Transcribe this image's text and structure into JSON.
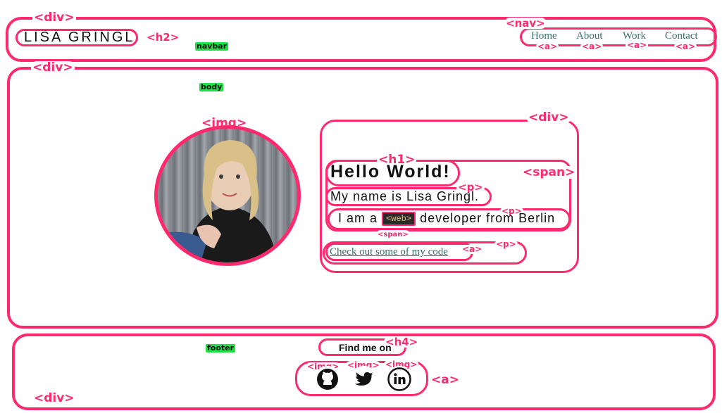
{
  "labels": {
    "div": "<div>",
    "nav": "<nav>",
    "h2": "<h2>",
    "a": "<a>",
    "img": "<img>",
    "h1": "<h1>",
    "span": "<span>",
    "p": "<p>",
    "h4": "<h4>"
  },
  "regions": {
    "navbar": "navbar",
    "body": "body",
    "footer": "footer"
  },
  "header": {
    "brand": "LISA GRINGL",
    "nav": [
      "Home",
      "About",
      "Work",
      "Contact"
    ]
  },
  "main": {
    "title": "Hello World!",
    "intro": "My name is Lisa Gringl.",
    "role_prefix": "I am a",
    "role_badge": "<web>",
    "role_suffix": "developer from Berlin",
    "code_link": "Check out some of my code"
  },
  "footer": {
    "heading": "Find me on",
    "socials": [
      "github-icon",
      "twitter-icon",
      "linkedin-icon"
    ]
  },
  "colors": {
    "annotation": "#ff2a6d",
    "link": "#3b6e68",
    "region_label": "#22e04a"
  }
}
